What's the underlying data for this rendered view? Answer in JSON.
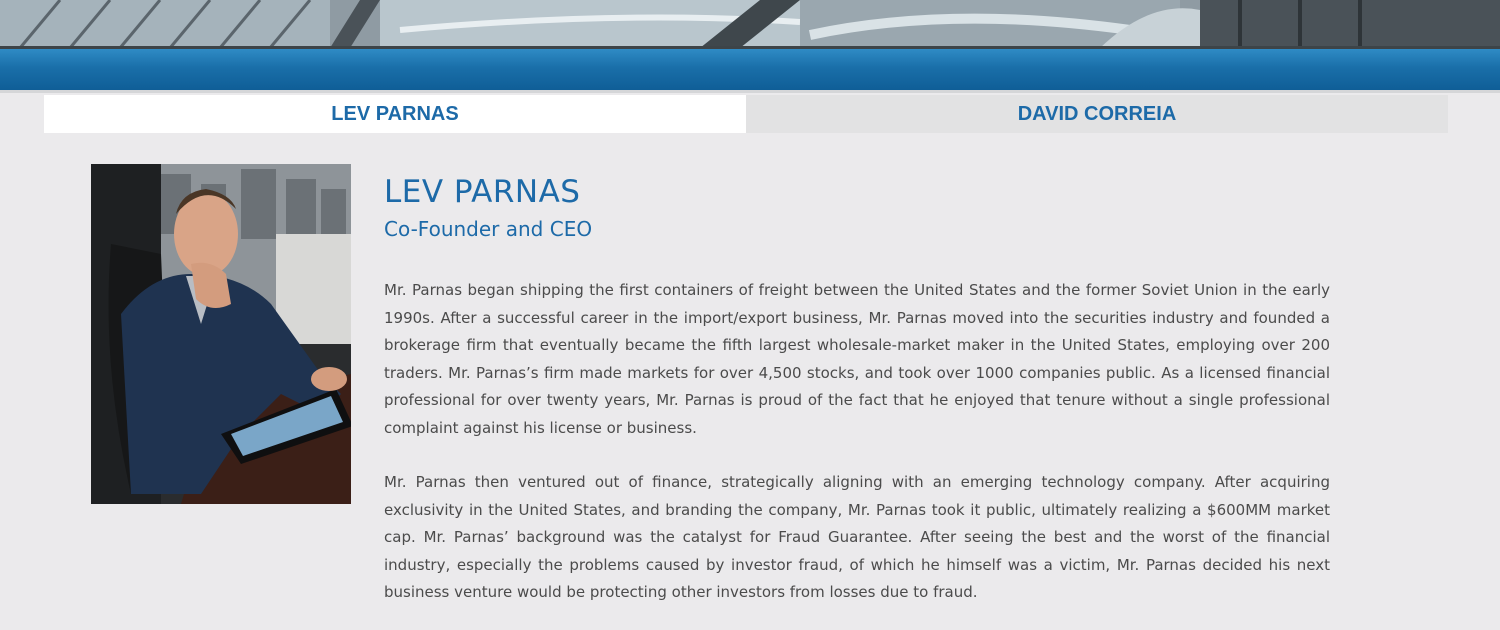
{
  "header": {
    "banner_image": "building-architecture-photo"
  },
  "tabs": [
    {
      "label": "LEV PARNAS",
      "active": true
    },
    {
      "label": "DAVID CORREIA",
      "active": false
    }
  ],
  "profile": {
    "photo": "lev-parnas-portrait",
    "name": "LEV PARNAS",
    "title": "Co-Founder and CEO",
    "bio": [
      "Mr. Parnas began shipping the first containers of freight between the United States and the former Soviet Union in the early 1990s. After a successful career in the import/export business, Mr. Parnas moved into the securities industry and founded a brokerage firm that eventually became the fifth largest wholesale-market maker in the United States, employing over 200 traders. Mr. Parnas’s firm made markets for over 4,500 stocks, and took over 1000 companies public. As a licensed financial professional for over twenty years, Mr. Parnas is proud of the fact that he enjoyed that tenure without a single professional complaint against his license or business.",
      "Mr. Parnas then ventured out of finance, strategically aligning with an emerging technology company. After acquiring exclusivity in the United States, and branding the company, Mr. Parnas took it public, ultimately realizing a $600MM market cap. Mr. Parnas’ background was the catalyst for Fraud Guarantee. After seeing the best and the worst of the financial industry, especially the problems caused by investor fraud, of which he himself was a victim, Mr. Parnas decided his next business venture would be protecting other investors from losses due to fraud."
    ]
  },
  "colors": {
    "accent": "#1d6aa8",
    "nav_bar": "#1a6fa9",
    "background": "#ebeaec",
    "body_text": "#4b4b4b"
  }
}
